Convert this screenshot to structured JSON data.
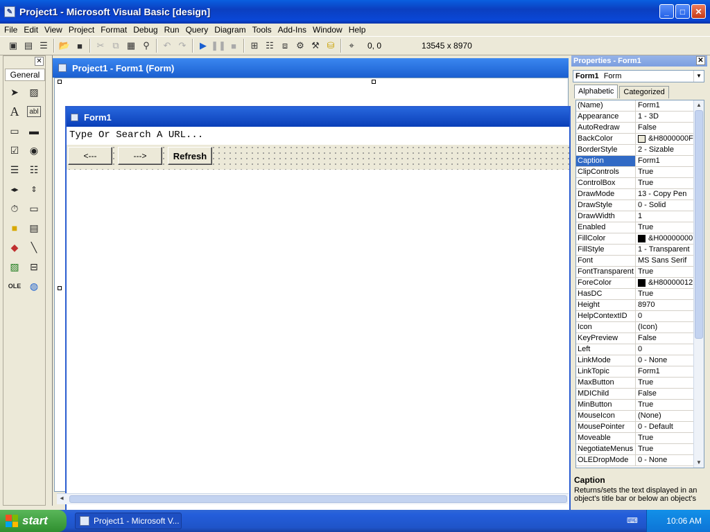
{
  "window": {
    "title": "Project1 - Microsoft Visual Basic [design]",
    "buttons": {
      "minimize": "_",
      "maximize": "□",
      "close": "✕"
    }
  },
  "menu": [
    "File",
    "Edit",
    "View",
    "Project",
    "Format",
    "Debug",
    "Run",
    "Query",
    "Diagram",
    "Tools",
    "Add-Ins",
    "Window",
    "Help"
  ],
  "toolbar": {
    "coords": "0, 0",
    "size": "13545 x 8970",
    "icons": [
      "add-project-icon",
      "add-form-icon",
      "menu-editor-icon",
      "open-icon",
      "save-icon",
      "cut-icon",
      "copy-icon",
      "paste-icon",
      "find-icon",
      "undo-icon",
      "redo-icon",
      "start-icon",
      "break-icon",
      "end-icon",
      "project-explorer-icon",
      "properties-window-icon",
      "form-layout-icon",
      "object-browser-icon",
      "toolbox-icon",
      "data-view-icon",
      "position-icon"
    ]
  },
  "toolbox": {
    "tab": "General",
    "close": "✕"
  },
  "project_window": {
    "title": "Project1 - Form1 (Form)"
  },
  "form": {
    "title": "Form1",
    "url_text": "Type Or Search A URL...",
    "back_label": "<---",
    "forward_label": "--->",
    "refresh_label": "Refresh"
  },
  "properties": {
    "title": "Properties - Form1",
    "close": "✕",
    "object_name": "Form1",
    "object_type": "Form",
    "tab_alpha": "Alphabetic",
    "tab_cat": "Categorized",
    "rows": [
      {
        "k": "(Name)",
        "v": "Form1"
      },
      {
        "k": "Appearance",
        "v": "1 - 3D"
      },
      {
        "k": "AutoRedraw",
        "v": "False"
      },
      {
        "k": "BackColor",
        "v": "&H8000000F",
        "swatch": "#ece9d8"
      },
      {
        "k": "BorderStyle",
        "v": "2 - Sizable"
      },
      {
        "k": "Caption",
        "v": "Form1",
        "selected": true
      },
      {
        "k": "ClipControls",
        "v": "True"
      },
      {
        "k": "ControlBox",
        "v": "True"
      },
      {
        "k": "DrawMode",
        "v": "13 - Copy Pen"
      },
      {
        "k": "DrawStyle",
        "v": "0 - Solid"
      },
      {
        "k": "DrawWidth",
        "v": "1"
      },
      {
        "k": "Enabled",
        "v": "True"
      },
      {
        "k": "FillColor",
        "v": "&H00000000",
        "swatch": "#000000"
      },
      {
        "k": "FillStyle",
        "v": "1 - Transparent"
      },
      {
        "k": "Font",
        "v": "MS Sans Serif"
      },
      {
        "k": "FontTransparent",
        "v": "True"
      },
      {
        "k": "ForeColor",
        "v": "&H80000012",
        "swatch": "#000000"
      },
      {
        "k": "HasDC",
        "v": "True"
      },
      {
        "k": "Height",
        "v": "8970"
      },
      {
        "k": "HelpContextID",
        "v": "0"
      },
      {
        "k": "Icon",
        "v": "(Icon)"
      },
      {
        "k": "KeyPreview",
        "v": "False"
      },
      {
        "k": "Left",
        "v": "0"
      },
      {
        "k": "LinkMode",
        "v": "0 - None"
      },
      {
        "k": "LinkTopic",
        "v": "Form1"
      },
      {
        "k": "MaxButton",
        "v": "True"
      },
      {
        "k": "MDIChild",
        "v": "False"
      },
      {
        "k": "MinButton",
        "v": "True"
      },
      {
        "k": "MouseIcon",
        "v": "(None)"
      },
      {
        "k": "MousePointer",
        "v": "0 - Default"
      },
      {
        "k": "Moveable",
        "v": "True"
      },
      {
        "k": "NegotiateMenus",
        "v": "True"
      },
      {
        "k": "OLEDropMode",
        "v": "0 - None"
      }
    ],
    "desc_title": "Caption",
    "desc_text": "Returns/sets the text displayed in an object's title bar or below an object's"
  },
  "taskbar": {
    "start": "start",
    "task": "Project1 - Microsoft V...",
    "clock": "10:06 AM"
  }
}
